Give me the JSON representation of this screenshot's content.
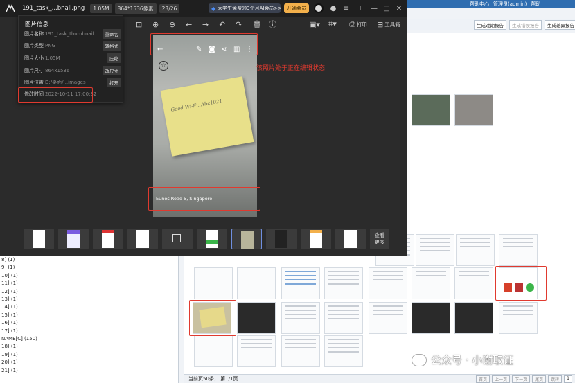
{
  "viewer": {
    "filename": "191_task_...bnail.png",
    "filesize": "1.05M",
    "dimensions": "864*1536像素",
    "position": "23/26",
    "promo": "大学生免费领3个月AI会员>>",
    "vip_button": "开通会员",
    "toolbar": {
      "print_label": "打印",
      "toolbox_label": "工具箱"
    },
    "more_label": [
      "查看",
      "更多"
    ]
  },
  "info_panel": {
    "title": "图片信息",
    "rows": [
      {
        "key": "图片名称",
        "value": "191_task_thumbnail",
        "button": "重命名"
      },
      {
        "key": "图片类型",
        "value": "PNG",
        "button": "转格式"
      },
      {
        "key": "图片大小",
        "value": "1.05M",
        "button": "压缩"
      },
      {
        "key": "图片尺寸",
        "value": "864x1536",
        "button": "改尺寸"
      },
      {
        "key": "图片位置",
        "value": "D:/桌面/...images",
        "button": "打开"
      },
      {
        "key": "修改时间",
        "value": "2022-10-11 17:00:32",
        "button": ""
      }
    ]
  },
  "photo": {
    "note_text": "Good  Wi-Fi: Abc1021",
    "location": "Eunos Road 5, Singapore"
  },
  "annotation": "该照片处于正在编辑状态",
  "bg_app": {
    "topbar": [
      "帮助中心",
      "管理员(admin)",
      "帮助"
    ],
    "toolbar_buttons": [
      {
        "label": "生成过期报告",
        "dim": false
      },
      {
        "label": "生成错误报告",
        "dim": true
      },
      {
        "label": "生成差异报告",
        "dim": false
      }
    ],
    "left_list": [
      "8] (1)",
      "9] (1)",
      "10] (1)",
      "11] (1)",
      "12] (1)",
      "13] (1)",
      "14] (1)",
      "15] (1)",
      "16] (1)",
      "17] (1)",
      "NAME[C] (150)",
      "18] (1)",
      "19] (1)",
      "20] (1)",
      "21] (1)"
    ],
    "status": "当前页50条，  第1/1页",
    "pager": [
      "首页",
      "上一页",
      "下一页",
      "尾页",
      "跳转",
      "1"
    ]
  },
  "watermark": "公众号 · 小谢取证",
  "colors": {
    "annotation_red": "#e03a2f",
    "viewer_bg": "#2b2b2b",
    "vip": "#f3b04b",
    "selected_border": "#6f8fe0"
  }
}
